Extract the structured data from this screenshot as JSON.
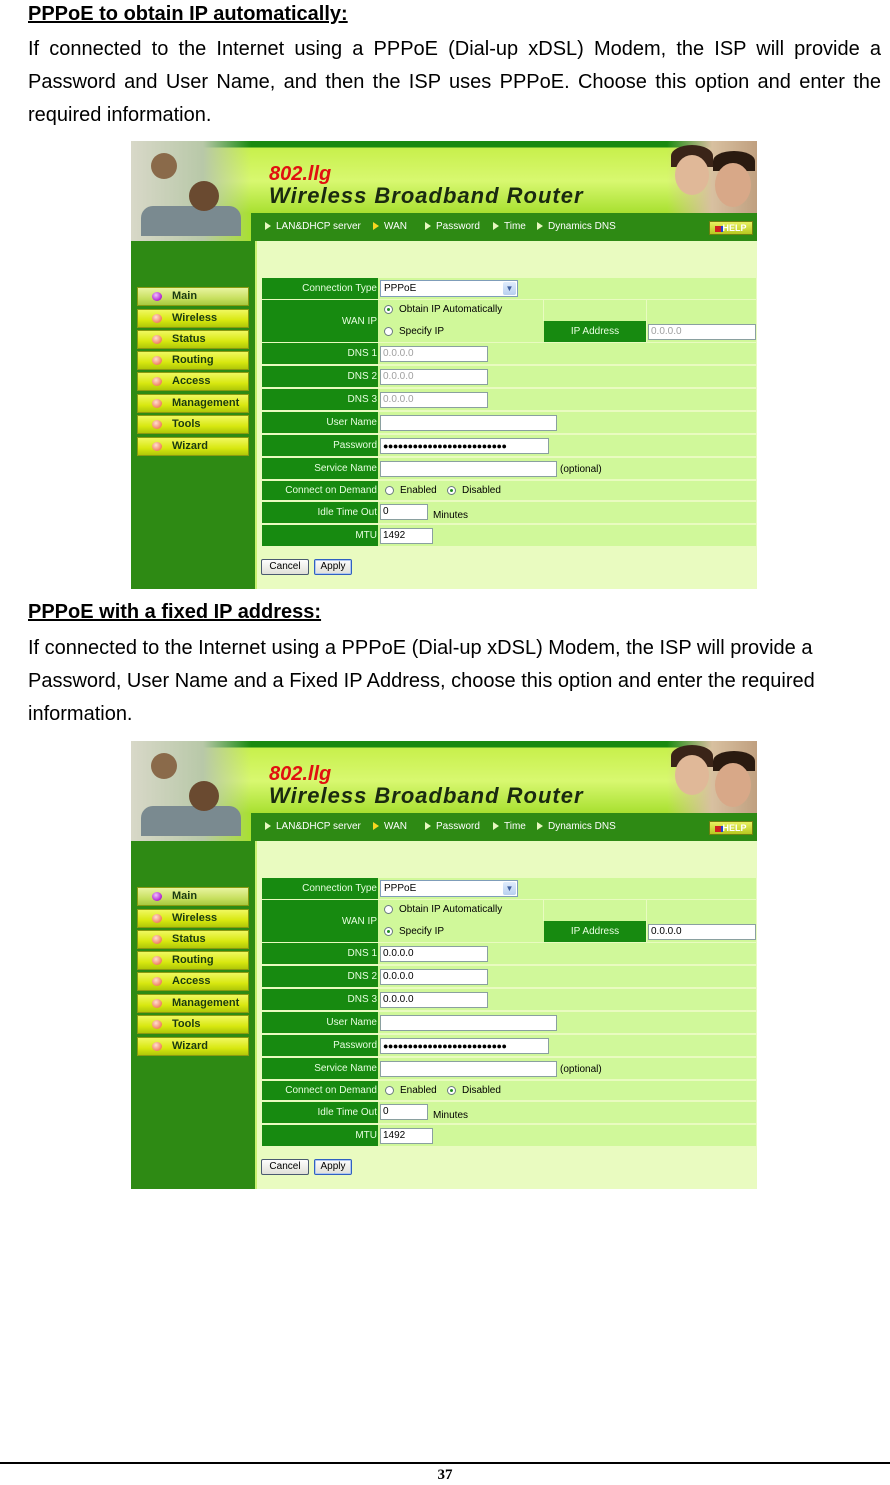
{
  "sections": [
    {
      "heading": "PPPoE to obtain IP automatically:",
      "paragraph": "If connected to the Internet using a PPPoE (Dial-up xDSL) Modem, the ISP will provide a Password and User Name, and then the ISP uses PPPoE. Choose this option and enter the required information.",
      "screenshot": {
        "banner": {
          "model": "802.llg",
          "title": "Wireless Broadband Router"
        },
        "nav": [
          "LAN&DHCP server",
          "WAN",
          "Password",
          "Time",
          "Dynamics DNS"
        ],
        "nav_active": "WAN",
        "help_label": "HELP",
        "sidebar": [
          "Main",
          "Wireless",
          "Status",
          "Routing",
          "Access",
          "Management",
          "Tools",
          "Wizard"
        ],
        "form": {
          "connection_type_label": "Connection Type",
          "connection_type_value": "PPPoE",
          "wan_ip_label": "WAN IP",
          "obtain_auto_label": "Obtain IP Automatically",
          "specify_ip_label": "Specify IP",
          "wan_ip_mode": "obtain",
          "ip_address_label": "IP Address",
          "ip_address_value": "0.0.0.0",
          "dns1_label": "DNS 1",
          "dns1_value": "0.0.0.0",
          "dns2_label": "DNS 2",
          "dns2_value": "0.0.0.0",
          "dns3_label": "DNS 3",
          "dns3_value": "0.0.0.0",
          "user_name_label": "User Name",
          "user_name_value": "",
          "password_label": "Password",
          "password_value": "●●●●●●●●●●●●●●●●●●●●●●●●●",
          "service_name_label": "Service Name",
          "service_name_value": "",
          "optional_note": "(optional)",
          "connect_on_demand_label": "Connect on Demand",
          "enabled_label": "Enabled",
          "disabled_label": "Disabled",
          "connect_on_demand": "disabled",
          "idle_time_out_label": "Idle Time Out",
          "idle_time_out_value": "0",
          "minutes_label": "Minutes",
          "mtu_label": "MTU",
          "mtu_value": "1492",
          "cancel_label": "Cancel",
          "apply_label": "Apply"
        }
      }
    },
    {
      "heading": "PPPoE with a fixed IP address:",
      "paragraph": "If connected to the Internet using a PPPoE (Dial-up xDSL) Modem, the ISP will provide a Password, User Name and a Fixed IP Address, choose this option and enter the required information.",
      "screenshot": {
        "banner": {
          "model": "802.llg",
          "title": "Wireless Broadband Router"
        },
        "nav": [
          "LAN&DHCP server",
          "WAN",
          "Password",
          "Time",
          "Dynamics DNS"
        ],
        "nav_active": "WAN",
        "help_label": "HELP",
        "sidebar": [
          "Main",
          "Wireless",
          "Status",
          "Routing",
          "Access",
          "Management",
          "Tools",
          "Wizard"
        ],
        "form": {
          "connection_type_label": "Connection Type",
          "connection_type_value": "PPPoE",
          "wan_ip_label": "WAN IP",
          "obtain_auto_label": "Obtain IP Automatically",
          "specify_ip_label": "Specify IP",
          "wan_ip_mode": "specify",
          "ip_address_label": "IP Address",
          "ip_address_value": "0.0.0.0",
          "dns1_label": "DNS 1",
          "dns1_value": "0.0.0.0",
          "dns2_label": "DNS 2",
          "dns2_value": "0.0.0.0",
          "dns3_label": "DNS 3",
          "dns3_value": "0.0.0.0",
          "user_name_label": "User Name",
          "user_name_value": "",
          "password_label": "Password",
          "password_value": "●●●●●●●●●●●●●●●●●●●●●●●●●",
          "service_name_label": "Service Name",
          "service_name_value": "",
          "optional_note": "(optional)",
          "connect_on_demand_label": "Connect on Demand",
          "enabled_label": "Enabled",
          "disabled_label": "Disabled",
          "connect_on_demand": "disabled",
          "idle_time_out_label": "Idle Time Out",
          "idle_time_out_value": "0",
          "minutes_label": "Minutes",
          "mtu_label": "MTU",
          "mtu_value": "1492",
          "cancel_label": "Cancel",
          "apply_label": "Apply"
        }
      }
    }
  ],
  "footer": {
    "page_number": "37"
  }
}
